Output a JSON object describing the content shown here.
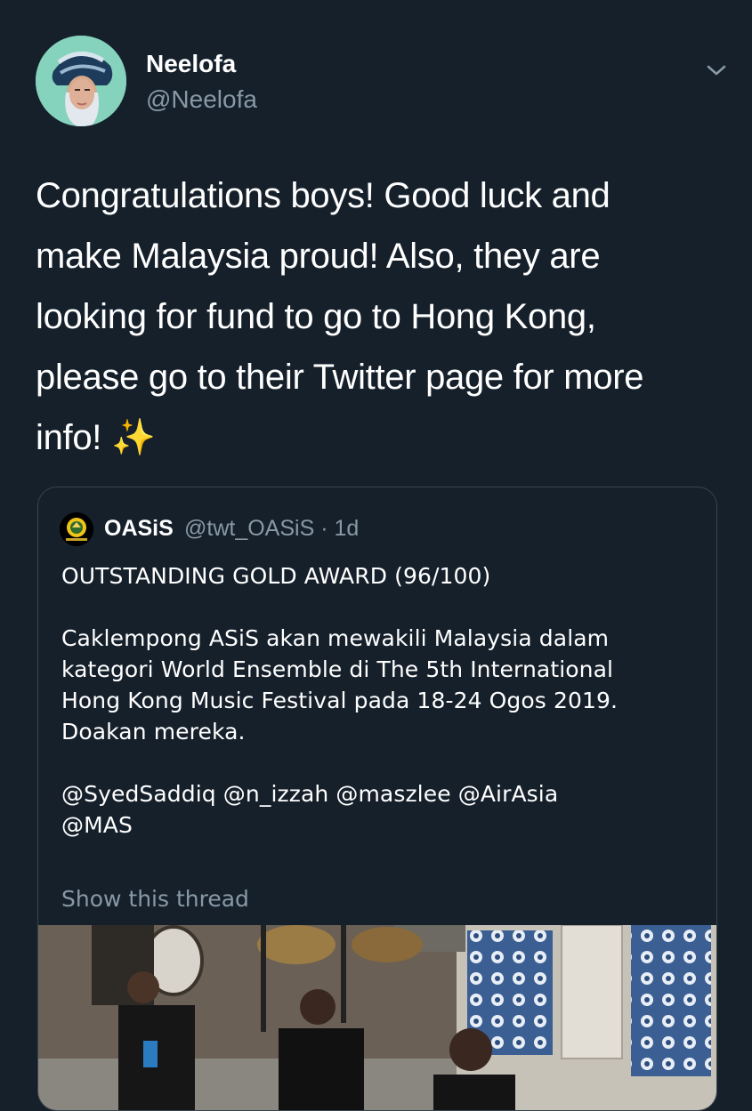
{
  "tweet": {
    "author": {
      "name": "Neelofa",
      "handle": "@Neelofa"
    },
    "text_lines": [
      "Congratulations boys! Good luck and",
      "make Malaysia proud! Also, they are",
      "looking for fund to go to Hong Kong,",
      "please go to their Twitter page for more",
      "info!"
    ],
    "emoji": "✨"
  },
  "quoted_tweet": {
    "name": "OASiS",
    "meta": "@twt_OASiS · 1d",
    "body_lines": [
      "OUTSTANDING GOLD AWARD (96/100)",
      "",
      "Caklempong ASiS akan mewakili Malaysia dalam",
      "kategori World Ensemble di The 5th International",
      "Hong Kong Music Festival pada 18-24 Ogos 2019.",
      "Doakan mereka.",
      "",
      "@SyedSaddiq @n_izzah @maszlee @AirAsia",
      "@MAS"
    ],
    "show_thread": "Show this thread"
  },
  "icons": {
    "caret": "chevron-down-icon",
    "media": "video-thumbnail"
  },
  "colors": {
    "background": "#15202b",
    "secondary_text": "#8899a6",
    "border": "#38444d"
  }
}
